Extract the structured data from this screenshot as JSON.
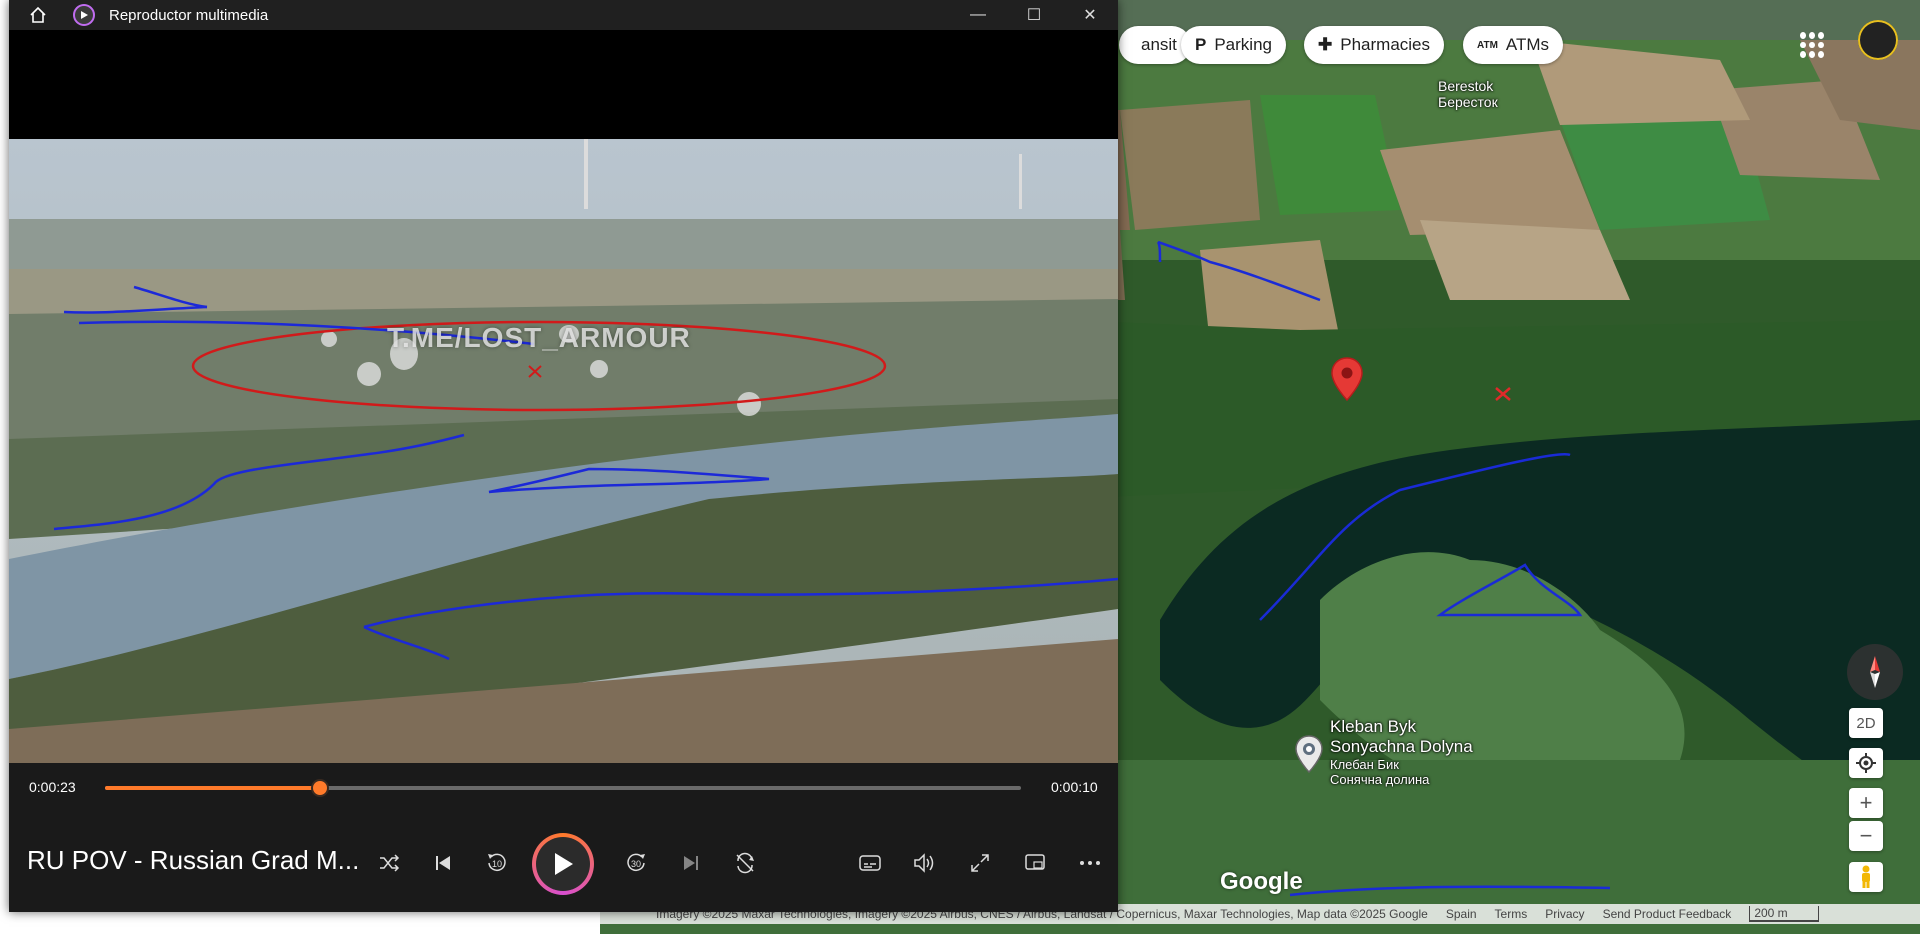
{
  "player": {
    "app_title": "Reproductor multimedia",
    "media_title": "RU POV - Russian Grad M...",
    "watermark": "T.ME/LOST_ARMOUR",
    "elapsed": "0:00:23",
    "remaining": "0:00:10",
    "progress_fraction": 0.235,
    "accent_color": "#ff7a2a",
    "controls": [
      "shuffle-icon",
      "previous-icon",
      "rewind-10-icon",
      "play-icon",
      "forward-30-icon",
      "next-icon",
      "repeat-icon",
      "subtitles-icon",
      "volume-icon",
      "fullscreen-icon",
      "mini-player-icon",
      "more-icon"
    ],
    "rewind_label": "10",
    "forward_label": "30"
  },
  "map": {
    "chips": [
      {
        "icon": "",
        "label": "ansit"
      },
      {
        "icon": "P",
        "label": "Parking"
      },
      {
        "icon": "✚",
        "label": "Pharmacies"
      },
      {
        "icon": "ATM",
        "label": "ATMs"
      }
    ],
    "places": {
      "berestok_latin": "Berestok",
      "berestok_cyrillic": "Берeсток",
      "kleban_latin_1": "Kleban Byk",
      "kleban_latin_2": "Sonyachna Dolyna",
      "kleban_cyrillic_1": "Клебан Бик",
      "kleban_cyrillic_2": "Сонячна долина"
    },
    "view_mode_label": "2D",
    "zoom_in_label": "+",
    "zoom_out_label": "−",
    "logo": "Google",
    "attribution": "Imagery ©2025 Maxar Technologies, Imagery ©2025 Airbus, CNES / Airbus, Landsat / Copernicus, Maxar Technologies, Map data ©2025 Google",
    "links": [
      "Spain",
      "Terms",
      "Privacy",
      "Send Product Feedback"
    ],
    "scale": "200 m"
  }
}
